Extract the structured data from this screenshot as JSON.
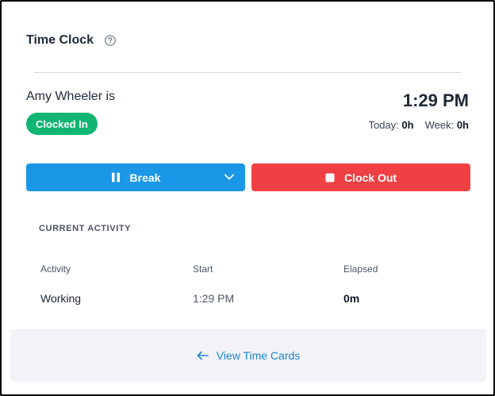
{
  "header": {
    "title": "Time Clock",
    "help_icon": "question-circle-icon"
  },
  "status": {
    "user_line": "Amy Wheeler is",
    "badge": "Clocked In",
    "badge_color": "#10b571",
    "current_time": "1:29 PM",
    "today_label": "Today:",
    "today_value": "0h",
    "week_label": "Week:",
    "week_value": "0h"
  },
  "actions": {
    "break_label": "Break",
    "break_icon": "pause-icon",
    "break_dropdown_icon": "chevron-down-icon",
    "break_color": "#1a97e6",
    "clockout_label": "Clock Out",
    "clockout_icon": "stop-icon",
    "clockout_color": "#ef4044"
  },
  "activity": {
    "section_title": "CURRENT ACTIVITY",
    "columns": [
      "Activity",
      "Start",
      "Elapsed"
    ],
    "rows": [
      {
        "activity": "Working",
        "start": "1:29 PM",
        "elapsed": "0m"
      }
    ]
  },
  "footer": {
    "link_label": "View Time Cards",
    "link_icon": "arrow-left-icon",
    "link_color": "#1a87cf"
  }
}
